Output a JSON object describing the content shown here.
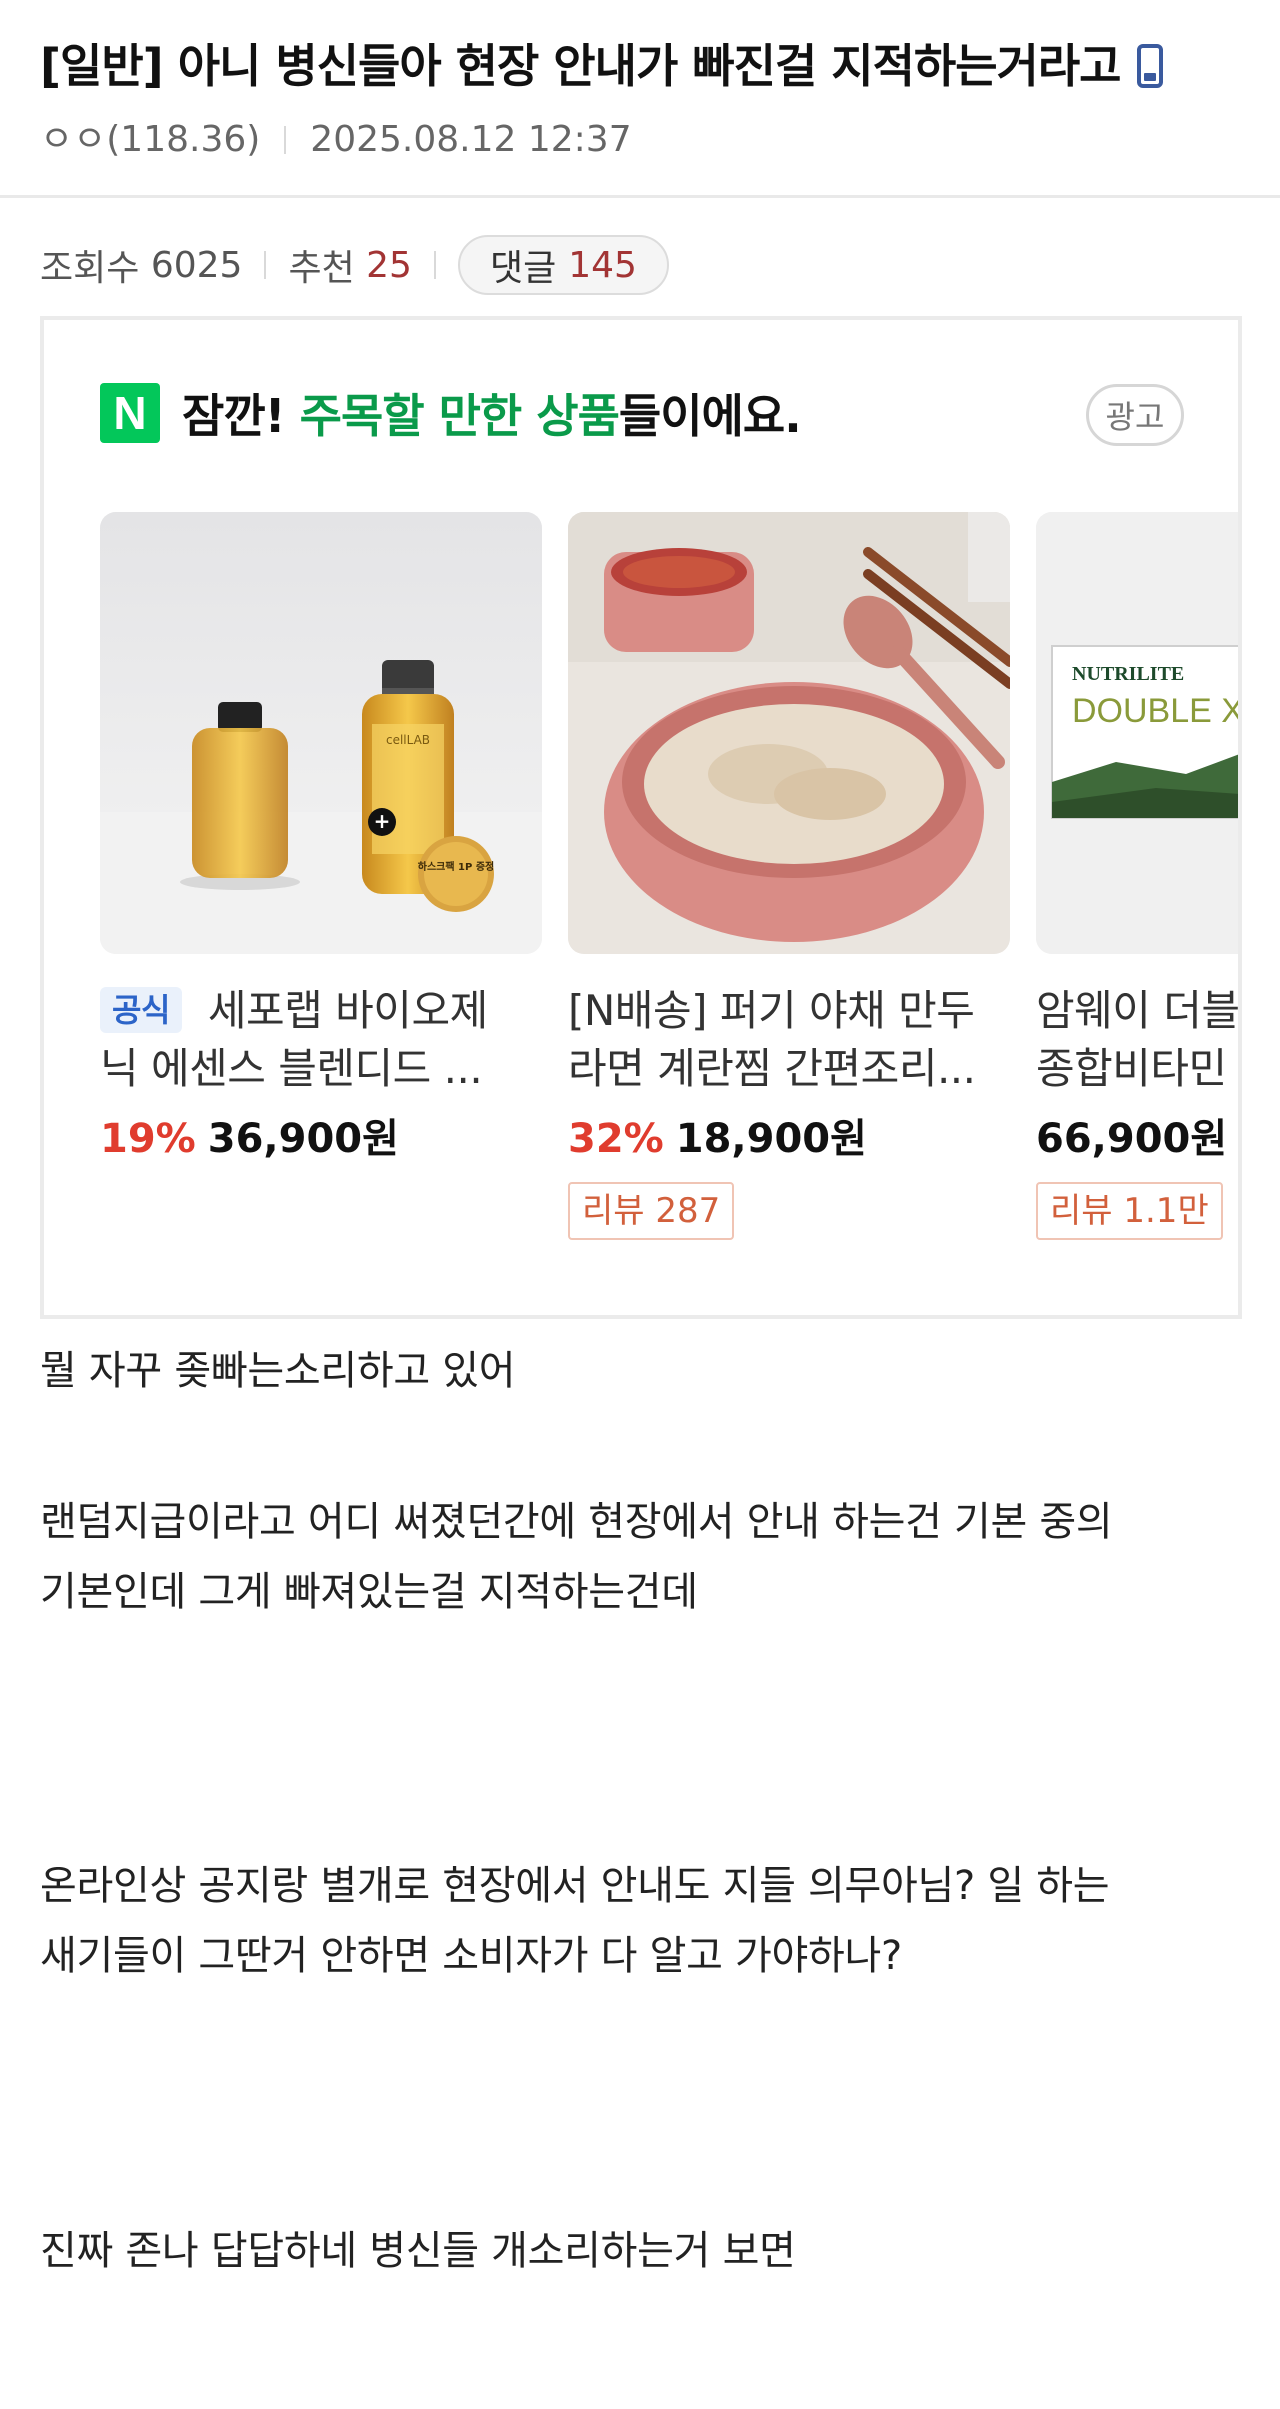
{
  "post": {
    "title": "[일반] 아니 병신들아 현장 안내가 빠진걸 지적하는거라고",
    "author": "ㅇㅇ(118.36)",
    "date": "2025.08.12 12:37",
    "device_icon": "mobile-phone-icon"
  },
  "stats": {
    "views_label": "조회수",
    "views": "6025",
    "recommend_label": "추천",
    "recommend": "25",
    "comments_label": "댓글",
    "comments": "145"
  },
  "ad": {
    "logo_letter": "N",
    "heading_prefix": "잠깐! ",
    "heading_highlight": "주목할 만한 상품",
    "heading_suffix": "들이에요.",
    "badge": "광고",
    "products": [
      {
        "tag": "공식",
        "name_line1": "세포랩 바이오제",
        "name_line2": "닉 에센스 블렌디드 ...",
        "discount": "19%",
        "price": "36,900원",
        "review": "",
        "image_text": "cellLAB",
        "image_badge": "하스크팩 1P 증정"
      },
      {
        "tag": "",
        "name_line1": "[N배송] 퍼기 야채 만두",
        "name_line2": "라면 계란찜 간편조리...",
        "discount": "32%",
        "price": "18,900원",
        "review": "리뷰 287"
      },
      {
        "tag": "",
        "name_line1": "암웨이 더블",
        "name_line2": "종합비타민",
        "discount": "",
        "price": "66,900원",
        "review": "리뷰 1.1만",
        "image_brand": "NUTRILITE",
        "image_product": "DOUBLE X"
      }
    ]
  },
  "content": {
    "p1": "뭘 자꾸 좆빠는소리하고 있어",
    "p2_line1": "랜덤지급이라고 어디 써졌던간에 현장에서 안내 하는건 기본 중의",
    "p2_line2": "기본인데 그게 빠져있는걸 지적하는건데",
    "p3_line1": "온라인상 공지랑 별개로 현장에서 안내도 지들 의무아님? 일 하는",
    "p3_line2": "새기들이 그딴거 안하면 소비자가 다 알고 가야하나?",
    "p4": "진짜 존나 답답하네 병신들 개소리하는거 보면"
  }
}
